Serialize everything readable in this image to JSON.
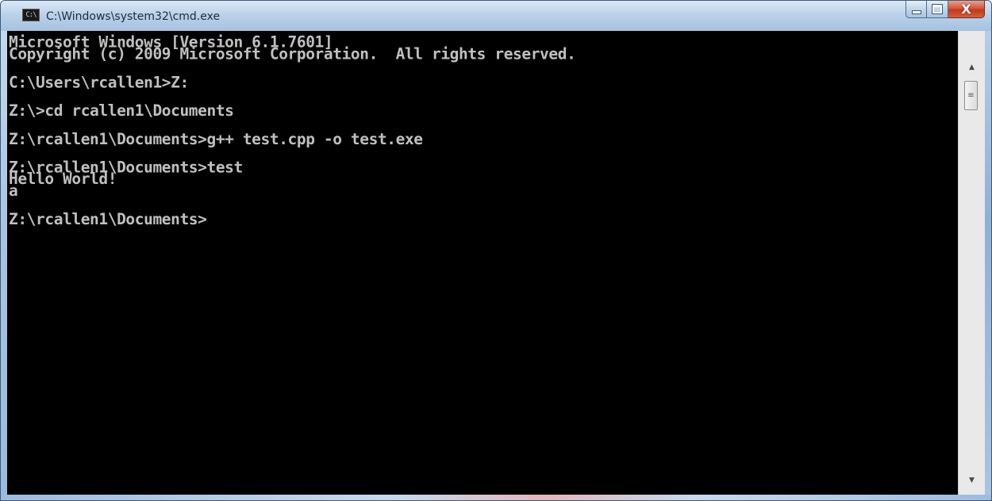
{
  "window": {
    "title": "C:\\Windows\\system32\\cmd.exe",
    "icon": "cmd-icon",
    "icon_text": "C:\\",
    "controls": {
      "minimize": "minimize-icon",
      "maximize": "maximize-icon",
      "close": "close-icon",
      "close_glyph": "X"
    }
  },
  "console": {
    "foreground": "#c0c0c0",
    "background": "#000000",
    "lines": [
      "Microsoft Windows [Version 6.1.7601]",
      "Copyright (c) 2009 Microsoft Corporation.  All rights reserved.",
      "",
      "C:\\Users\\rcallen1>Z:",
      "",
      "Z:\\>cd rcallen1\\Documents",
      "",
      "Z:\\rcallen1\\Documents>g++ test.cpp -o test.exe",
      "",
      "Z:\\rcallen1\\Documents>test",
      "Hello World!",
      "a",
      "",
      "Z:\\rcallen1\\Documents>"
    ]
  },
  "scrollbar": {
    "up_icon": "scroll-up-arrow-icon",
    "up_glyph": "▲",
    "down_icon": "scroll-down-arrow-icon",
    "down_glyph": "▼",
    "thumb_glyph": "≡"
  }
}
